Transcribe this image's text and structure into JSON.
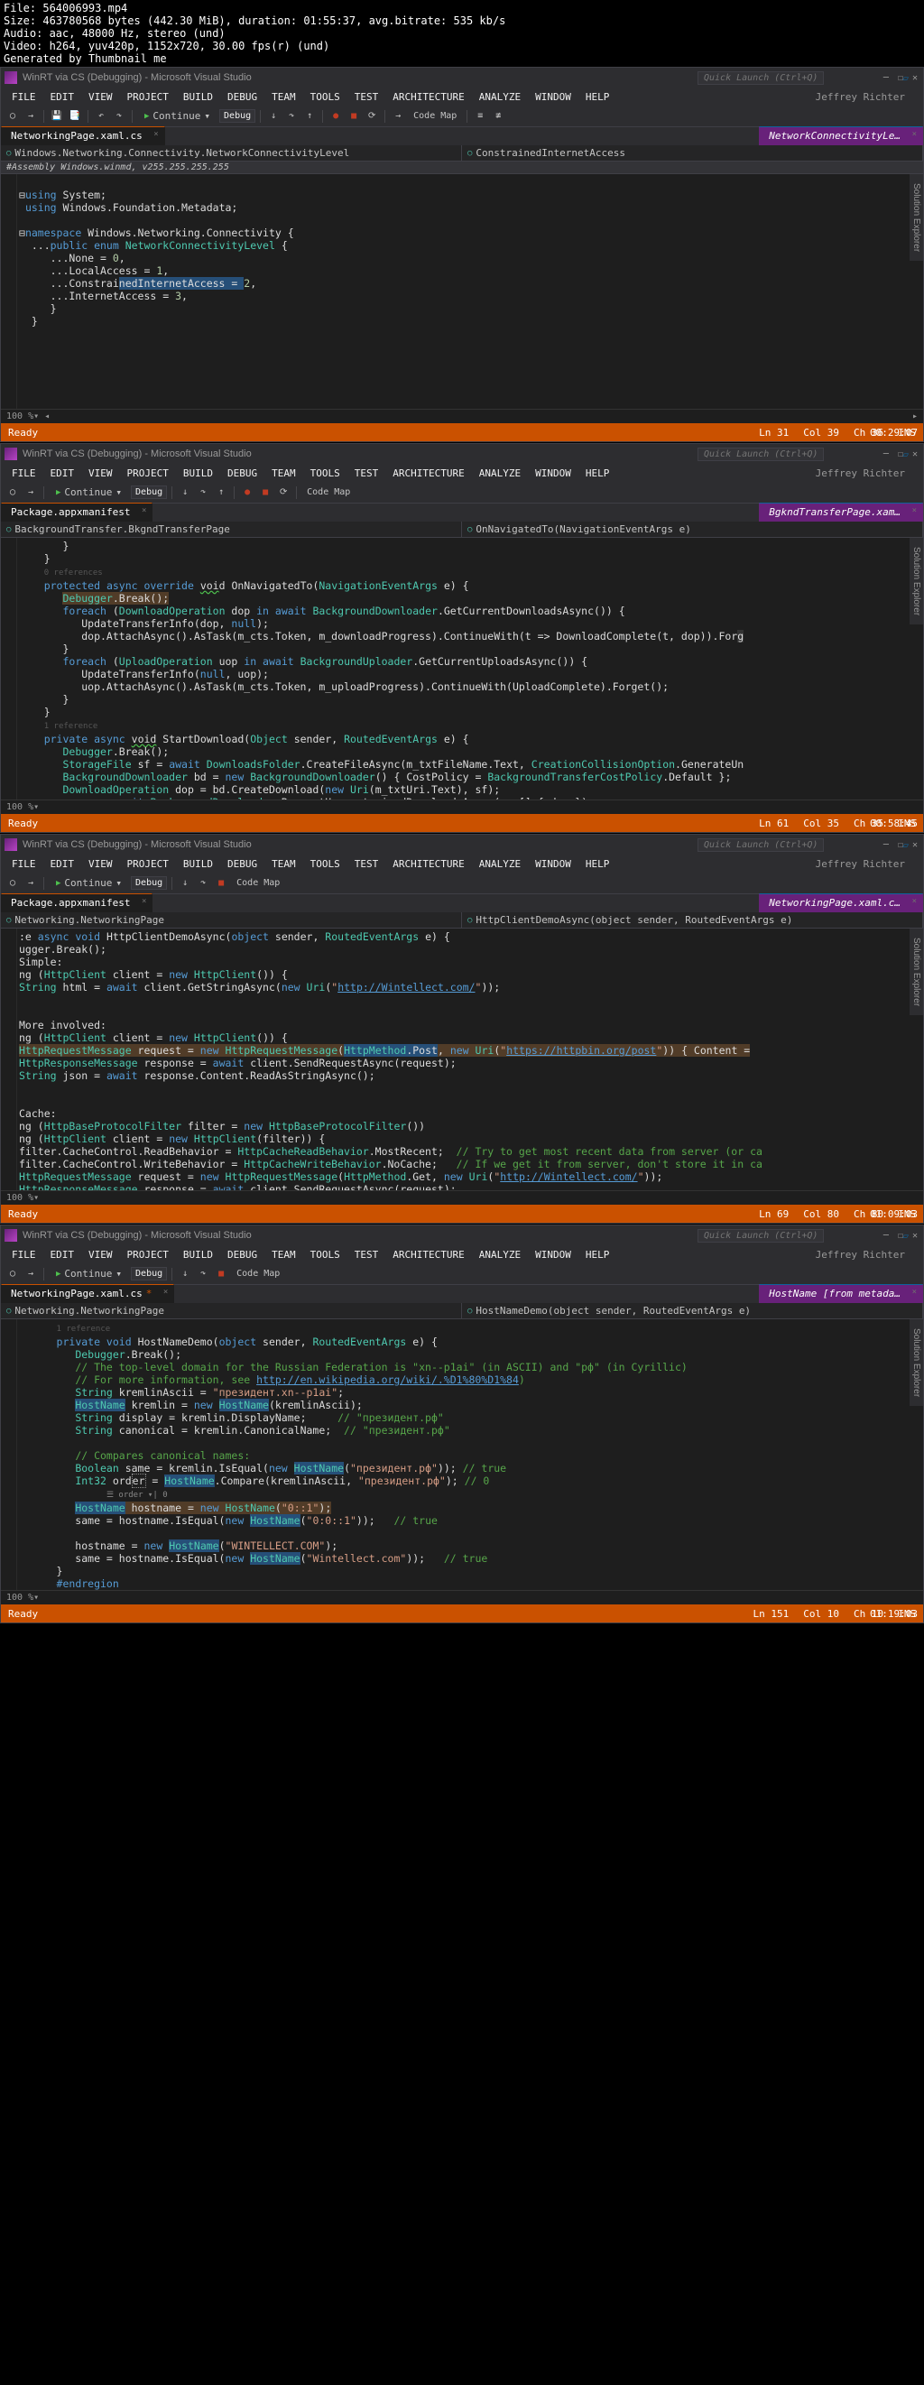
{
  "video_meta": {
    "file": "File: 564006993.mp4",
    "size": "Size: 463780568 bytes (442.30 MiB), duration: 01:55:37, avg.bitrate: 535 kb/s",
    "audio": "Audio: aac, 48000 Hz, stereo (und)",
    "video": "Video: h264, yuv420p, 1152x720, 30.00 fps(r) (und)",
    "gen": "Generated by Thumbnail me"
  },
  "common": {
    "title": "WinRT via CS (Debugging) - Microsoft Visual Studio",
    "quick_launch": "Quick Launch (Ctrl+Q)",
    "user": "Jeffrey Richter",
    "menus": [
      "FILE",
      "EDIT",
      "VIEW",
      "PROJECT",
      "BUILD",
      "DEBUG",
      "TEAM",
      "TOOLS",
      "TEST",
      "ARCHITECTURE",
      "ANALYZE",
      "WINDOW",
      "HELP"
    ],
    "continue": "Continue",
    "debug_cfg": "Debug",
    "code_map": "Code Map",
    "ready": "Ready",
    "zoom": "100 %",
    "vert_tab": "Solution Explorer"
  },
  "pane1": {
    "tab_active": "NetworkingPage.xaml.cs",
    "tab_right": "NetworkConnectivityLe…",
    "nav_left": "Windows.Networking.Connectivity.NetworkConnectivityLevel",
    "nav_right": "ConstrainedInternetAccess",
    "assembly": "#Assembly Windows.winmd, v255.255.255.255",
    "status": {
      "ln": "Ln 31",
      "col": "Col 39",
      "ch": "Ch 36",
      "ts": "00:29:07"
    }
  },
  "pane2": {
    "tab_active": "Package.appxmanifest",
    "tab_right": "BgkndTransferPage.xam…",
    "nav_left": "BackgroundTransfer.BkgndTransferPage",
    "nav_right": "OnNavigatedTo(NavigationEventArgs e)",
    "status": {
      "ln": "Ln 61",
      "col": "Col 35",
      "ch": "Ch 35",
      "ts": "00:58:45"
    }
  },
  "pane3": {
    "tab_active": "Package.appxmanifest",
    "tab_right": "NetworkingPage.xaml.c…",
    "nav_left": "Networking.NetworkingPage",
    "nav_right": "HttpClientDemoAsync(object sender, RoutedEventArgs e)",
    "status": {
      "ln": "Ln 69",
      "col": "Col 80",
      "ch": "Ch 80",
      "ts": "01:09:03"
    }
  },
  "pane4": {
    "tab_active": "NetworkingPage.xaml.cs",
    "tab_right": "HostName [from metada…",
    "nav_left": "Networking.NetworkingPage",
    "nav_right": "HostNameDemo(object sender, RoutedEventArgs e)",
    "status": {
      "ln": "Ln 151",
      "col": "Col 10",
      "ch": "Ch 10",
      "ts": "01:19:03"
    }
  }
}
